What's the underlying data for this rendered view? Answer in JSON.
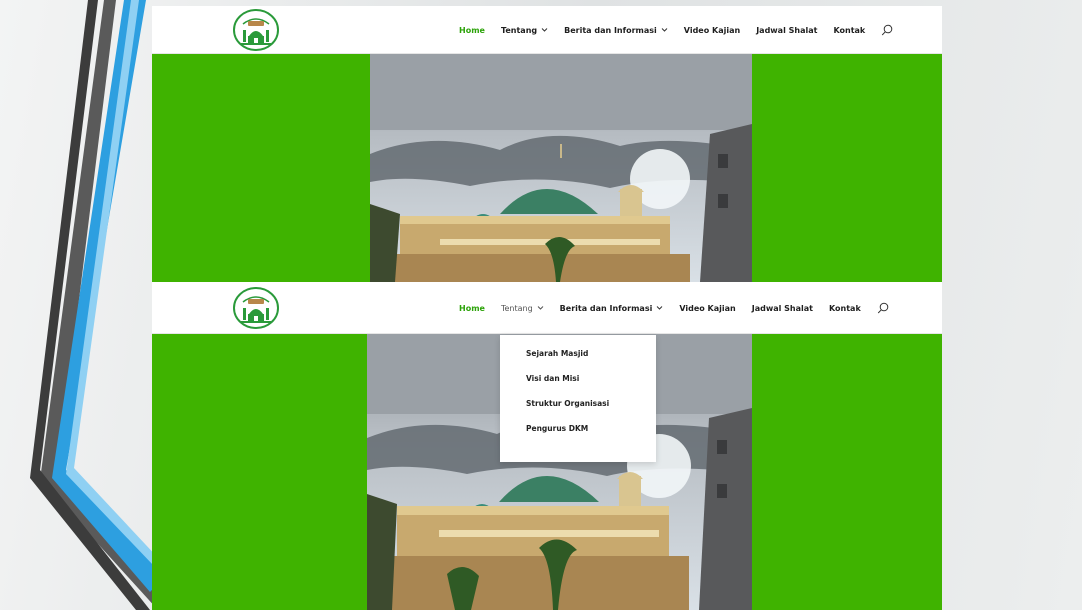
{
  "site": {
    "logo_name": "mosque-logo"
  },
  "nav": {
    "home": "Home",
    "tentang": "Tentang",
    "berita": "Berita dan Informasi",
    "video": "Video Kajian",
    "jadwal": "Jadwal Shalat",
    "kontak": "Kontak"
  },
  "dropdown": {
    "items": [
      "Sejarah Masjid",
      "Visi dan Misi",
      "Struktur Organisasi",
      "Pengurus DKM"
    ]
  },
  "colors": {
    "accent": "#2da30a",
    "side_panel": "#3fb300",
    "header_bg": "#ffffff"
  }
}
